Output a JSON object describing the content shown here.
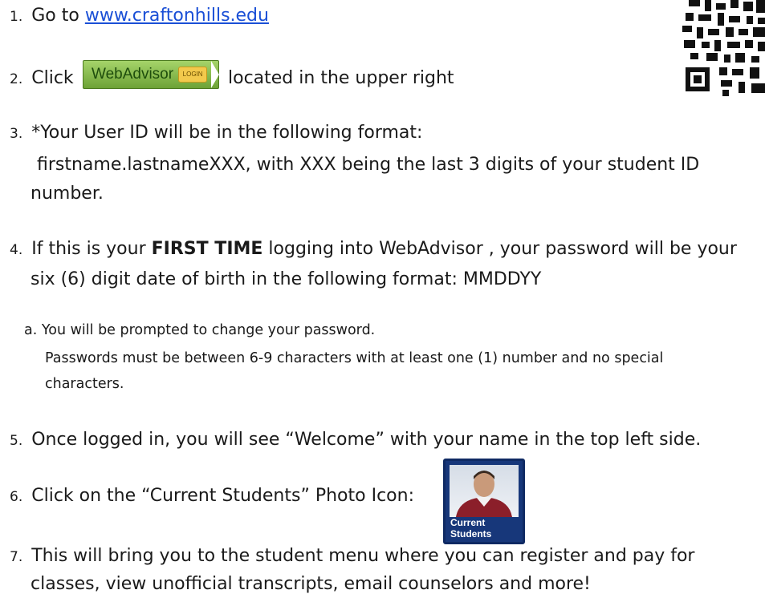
{
  "steps": {
    "s1": {
      "num": "1.",
      "text": "Go to ",
      "link": "www.craftonhills.edu"
    },
    "s2": {
      "num": "2.",
      "text_before": "Click",
      "button_label": "WebAdvisor",
      "button_key_label": "LOGIN",
      "text_after": "located in the upper right"
    },
    "s3": {
      "num": "3.",
      "line1": "*Your User ID will be in the following format:",
      "line2": "firstname.lastnameXXX, with XXX being the last 3 digits of your student ID",
      "line3": "number."
    },
    "s4": {
      "num": "4.",
      "line1_before": "If this is your ",
      "line1_bold": "FIRST TIME",
      "line1_after": " logging into WebAdvisor , your password will be your",
      "line2": "six (6) digit date of birth in the following format: MMDDYY"
    },
    "s4a": {
      "num": "a.",
      "line1": "You will be prompted to change your password.",
      "line2": "Passwords must be between 6-9 characters with at least one (1) number and no special",
      "line3": "characters."
    },
    "s5": {
      "num": "5.",
      "text": "Once logged in, you will see “Welcome” with your name in the top left side."
    },
    "s6": {
      "num": "6.",
      "text": "Click on the “Current Students” Photo Icon:",
      "icon_caption_1": "Current",
      "icon_caption_2": "Students"
    },
    "s7": {
      "num": "7.",
      "line1": "This will bring you to the student menu where you can register and pay for",
      "line2": "classes, view unofficial transcripts, email counselors and more!"
    }
  },
  "colors": {
    "link": "#1a4fd6",
    "button_green": "#7fb443",
    "photo_frame": "#17377a"
  },
  "icons": {
    "qr": "qr-code-icon",
    "photo": "current-students-photo-icon",
    "key": "key-icon"
  }
}
